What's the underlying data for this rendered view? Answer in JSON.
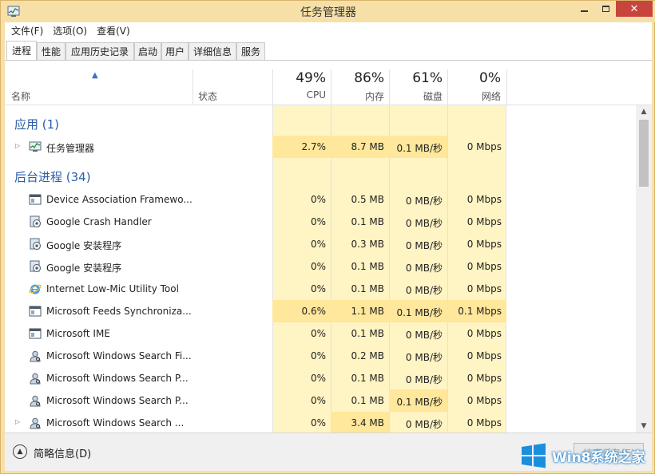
{
  "window": {
    "title": "任务管理器"
  },
  "menu": [
    "文件(F)",
    "选项(O)",
    "查看(V)"
  ],
  "tabs": [
    "进程",
    "性能",
    "应用历史记录",
    "启动",
    "用户",
    "详细信息",
    "服务"
  ],
  "columns": {
    "name": "名称",
    "status": "状态",
    "cpu": {
      "pct": "49%",
      "label": "CPU"
    },
    "mem": {
      "pct": "86%",
      "label": "内存"
    },
    "disk": {
      "pct": "61%",
      "label": "磁盘"
    },
    "net": {
      "pct": "0%",
      "label": "网络"
    }
  },
  "groups": {
    "apps": "应用 (1)",
    "background": "后台进程 (34)"
  },
  "apps": [
    {
      "name": "任务管理器",
      "cpu": "2.7%",
      "mem": "8.7 MB",
      "disk": "0.1 MB/秒",
      "net": "0 Mbps",
      "icon": "task-manager-icon",
      "expandable": true
    }
  ],
  "background": [
    {
      "name": "Device Association Framewo...",
      "cpu": "0%",
      "mem": "0.5 MB",
      "disk": "0 MB/秒",
      "net": "0 Mbps",
      "icon": "window-icon"
    },
    {
      "name": "Google Crash Handler",
      "cpu": "0%",
      "mem": "0.1 MB",
      "disk": "0 MB/秒",
      "net": "0 Mbps",
      "icon": "installer-icon"
    },
    {
      "name": "Google 安装程序",
      "cpu": "0%",
      "mem": "0.3 MB",
      "disk": "0 MB/秒",
      "net": "0 Mbps",
      "icon": "installer-icon"
    },
    {
      "name": "Google 安装程序",
      "cpu": "0%",
      "mem": "0.1 MB",
      "disk": "0 MB/秒",
      "net": "0 Mbps",
      "icon": "installer-icon"
    },
    {
      "name": "Internet Low-Mic Utility Tool",
      "cpu": "0%",
      "mem": "0.1 MB",
      "disk": "0 MB/秒",
      "net": "0 Mbps",
      "icon": "ie-icon"
    },
    {
      "name": "Microsoft Feeds Synchroniza...",
      "cpu": "0.6%",
      "mem": "1.1 MB",
      "disk": "0.1 MB/秒",
      "net": "0.1 Mbps",
      "icon": "window-icon"
    },
    {
      "name": "Microsoft IME",
      "cpu": "0%",
      "mem": "0.1 MB",
      "disk": "0 MB/秒",
      "net": "0 Mbps",
      "icon": "window-icon"
    },
    {
      "name": "Microsoft Windows Search Fi...",
      "cpu": "0%",
      "mem": "0.2 MB",
      "disk": "0 MB/秒",
      "net": "0 Mbps",
      "icon": "search-user-icon"
    },
    {
      "name": "Microsoft Windows Search P...",
      "cpu": "0%",
      "mem": "0.1 MB",
      "disk": "0 MB/秒",
      "net": "0 Mbps",
      "icon": "search-user-icon"
    },
    {
      "name": "Microsoft Windows Search P...",
      "cpu": "0%",
      "mem": "0.1 MB",
      "disk": "0.1 MB/秒",
      "net": "0 Mbps",
      "icon": "search-user-icon"
    },
    {
      "name": "Microsoft Windows Search ...",
      "cpu": "0%",
      "mem": "3.4 MB",
      "disk": "0 MB/秒",
      "net": "0 Mbps",
      "icon": "search-user-icon",
      "expandable": true
    }
  ],
  "footer": {
    "less_details": "简略信息(D)",
    "end_task": "结束任务(E)"
  },
  "watermark": {
    "text": "Win8系统之家"
  },
  "colors": {
    "heat_light": "#fff4c4",
    "heat_mid": "#ffe79b",
    "accent": "#2a5ea8"
  }
}
